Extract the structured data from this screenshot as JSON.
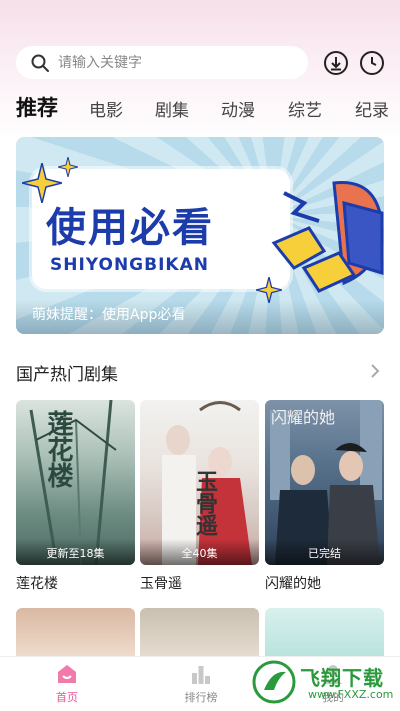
{
  "search": {
    "placeholder": "请输入关键字",
    "icon": "search-icon",
    "download_icon": "download-icon",
    "history_icon": "history-clock-icon"
  },
  "tabs": [
    {
      "label": "推荐",
      "active": true
    },
    {
      "label": "电影",
      "active": false
    },
    {
      "label": "剧集",
      "active": false
    },
    {
      "label": "动漫",
      "active": false
    },
    {
      "label": "综艺",
      "active": false
    },
    {
      "label": "纪录",
      "active": false
    }
  ],
  "banner": {
    "title": "使用必看",
    "subtitle": "SHIYONGBIKAN",
    "caption": "萌妹提醒：使用App必看"
  },
  "section": {
    "title": "国产热门剧集",
    "more_icon": "chevron-right-icon"
  },
  "shows": [
    {
      "title": "莲花楼",
      "badge": "更新至18集",
      "poster_text": "莲花楼"
    },
    {
      "title": "玉骨遥",
      "badge": "全40集",
      "poster_text": "玉骨遥"
    },
    {
      "title": "闪耀的她",
      "badge": "已完结",
      "poster_text": "闪耀的她"
    }
  ],
  "bottom_nav": [
    {
      "label": "首页",
      "icon": "home-icon",
      "active": true
    },
    {
      "label": "排行榜",
      "icon": "bar-chart-icon",
      "active": false
    },
    {
      "label": "我的",
      "icon": "user-icon",
      "active": false
    }
  ],
  "watermark": {
    "text": "飞翔下载",
    "url": "www.FXXZ.com"
  },
  "colors": {
    "accent": "#e6579a",
    "banner_title": "#1d3cab"
  }
}
